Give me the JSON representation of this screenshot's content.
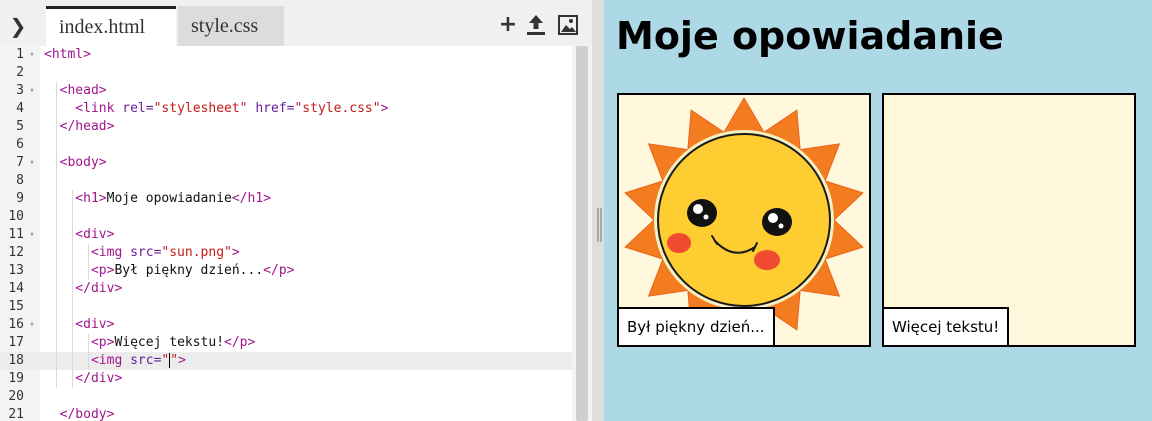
{
  "editor": {
    "toggle_icon": "chevron-right-icon",
    "toggle_glyph": "❯",
    "tabs": [
      {
        "label": "index.html",
        "active": true
      },
      {
        "label": "style.css",
        "active": false
      }
    ],
    "toolbar": {
      "add_icon": "plus-icon",
      "add_glyph": "+",
      "upload_icon": "upload-icon",
      "upload_glyph": "⬆",
      "image_icon": "image-icon",
      "image_glyph": "▣"
    },
    "code_lines": [
      {
        "n": "1",
        "fold": true,
        "tokens": [
          [
            "tag",
            "<html>"
          ]
        ]
      },
      {
        "n": "2",
        "fold": false,
        "tokens": []
      },
      {
        "n": "3",
        "fold": true,
        "tokens": [
          [
            "tag",
            "  <head>"
          ]
        ]
      },
      {
        "n": "4",
        "fold": false,
        "tokens": [
          [
            "tag",
            "    <link "
          ],
          [
            "attr",
            "rel="
          ],
          [
            "val",
            "\"stylesheet\""
          ],
          [
            "attr",
            " href="
          ],
          [
            "val",
            "\"style.css\""
          ],
          [
            "tag",
            ">"
          ]
        ]
      },
      {
        "n": "5",
        "fold": false,
        "tokens": [
          [
            "tag",
            "  </head>"
          ]
        ]
      },
      {
        "n": "6",
        "fold": false,
        "tokens": []
      },
      {
        "n": "7",
        "fold": true,
        "tokens": [
          [
            "tag",
            "  <body>"
          ]
        ]
      },
      {
        "n": "8",
        "fold": false,
        "tokens": []
      },
      {
        "n": "9",
        "fold": false,
        "tokens": [
          [
            "tag",
            "    <h1>"
          ],
          [
            "txt",
            "Moje opowiadanie"
          ],
          [
            "tag",
            "</h1>"
          ]
        ]
      },
      {
        "n": "10",
        "fold": false,
        "tokens": []
      },
      {
        "n": "11",
        "fold": true,
        "tokens": [
          [
            "tag",
            "    <div>"
          ]
        ]
      },
      {
        "n": "12",
        "fold": false,
        "tokens": [
          [
            "tag",
            "      <img "
          ],
          [
            "attr",
            "src="
          ],
          [
            "val",
            "\"sun.png\""
          ],
          [
            "tag",
            ">"
          ]
        ]
      },
      {
        "n": "13",
        "fold": false,
        "tokens": [
          [
            "tag",
            "      <p>"
          ],
          [
            "txt",
            "Był piękny dzień..."
          ],
          [
            "tag",
            "</p>"
          ]
        ]
      },
      {
        "n": "14",
        "fold": false,
        "tokens": [
          [
            "tag",
            "    </div>"
          ]
        ]
      },
      {
        "n": "15",
        "fold": false,
        "tokens": []
      },
      {
        "n": "16",
        "fold": true,
        "tokens": [
          [
            "tag",
            "    <div>"
          ]
        ]
      },
      {
        "n": "17",
        "fold": false,
        "tokens": [
          [
            "tag",
            "      <p>"
          ],
          [
            "txt",
            "Więcej tekstu!"
          ],
          [
            "tag",
            "</p>"
          ]
        ]
      },
      {
        "n": "18",
        "fold": false,
        "active": true,
        "tokens": [
          [
            "tag",
            "      <img "
          ],
          [
            "attr",
            "src="
          ],
          [
            "val",
            "\""
          ],
          [
            "cursor",
            ""
          ],
          [
            "val",
            "\""
          ],
          [
            "tag",
            ">"
          ]
        ]
      },
      {
        "n": "19",
        "fold": false,
        "tokens": [
          [
            "tag",
            "    </div>"
          ]
        ]
      },
      {
        "n": "20",
        "fold": false,
        "tokens": []
      },
      {
        "n": "21",
        "fold": false,
        "tokens": [
          [
            "tag",
            "  </body>"
          ]
        ]
      }
    ]
  },
  "preview": {
    "title": "Moje opowiadanie",
    "panels": [
      {
        "image": "sun-illustration",
        "caption": "Był piękny dzień..."
      },
      {
        "image": "",
        "caption": "Więcej tekstu!"
      }
    ]
  },
  "colors": {
    "preview_bg": "#add8e6",
    "panel_bg": "#fff8dc",
    "tag": "#a0148c",
    "string": "#c41a16",
    "sun_rays": "#f47c20",
    "sun_face": "#fecd32",
    "cheeks": "#f04b30"
  }
}
